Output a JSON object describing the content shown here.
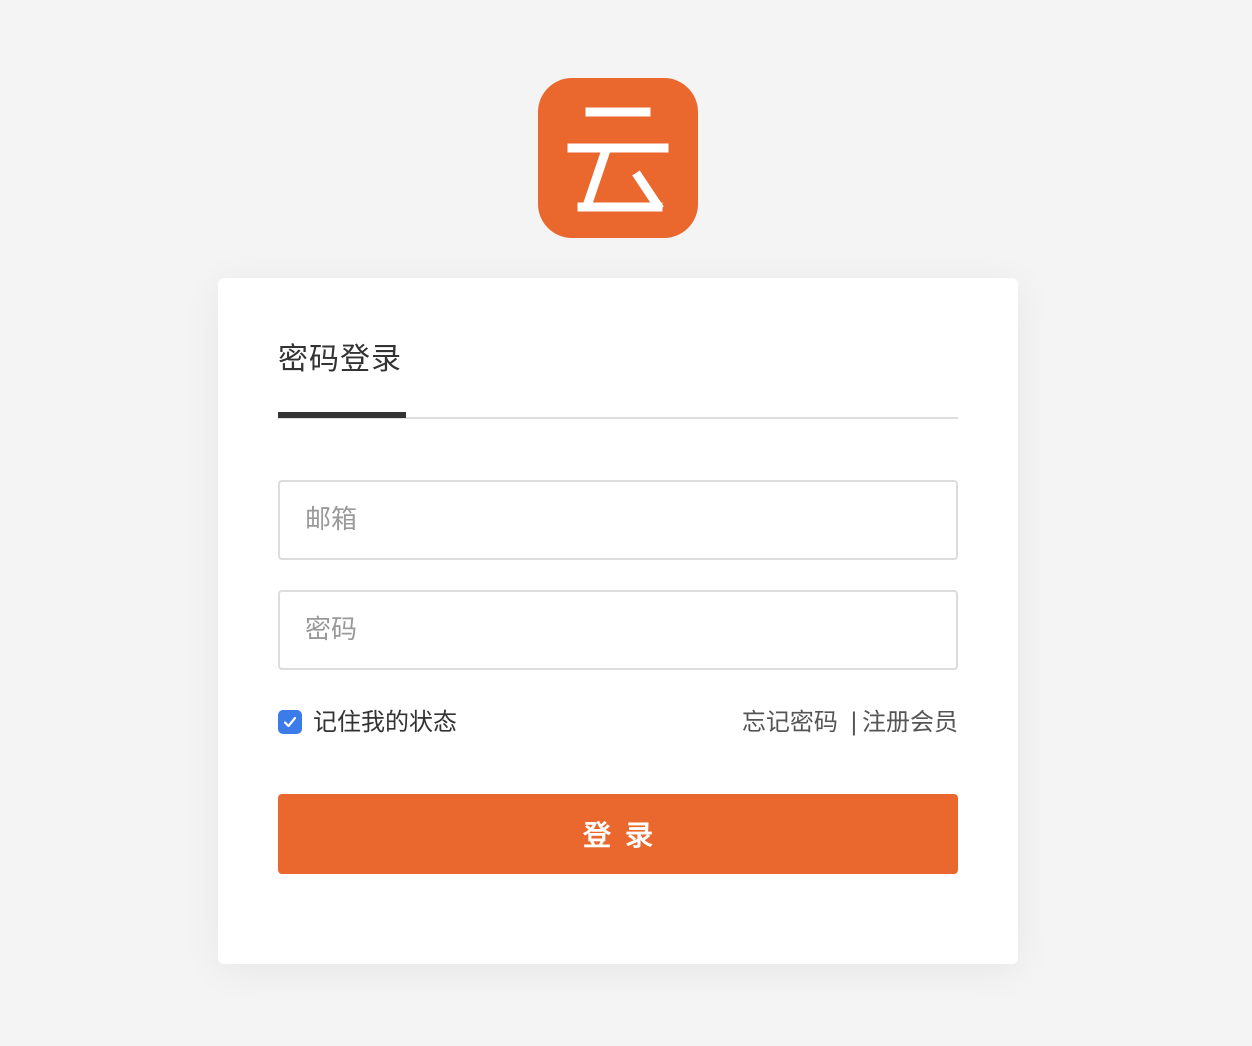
{
  "logo": {
    "icon": "cloud-character-logo-icon",
    "color": "#ea672e"
  },
  "login": {
    "tab_title": "密码登录",
    "email_placeholder": "邮箱",
    "email_value": "",
    "password_placeholder": "密码",
    "password_value": "",
    "remember_label": "记住我的状态",
    "remember_checked": true,
    "forgot_password": "忘记密码",
    "separator": "|",
    "register": "注册会员",
    "submit_label": "登录"
  },
  "colors": {
    "accent": "#ea672e",
    "checkbox": "#3b7bea",
    "background": "#f4f4f4"
  }
}
